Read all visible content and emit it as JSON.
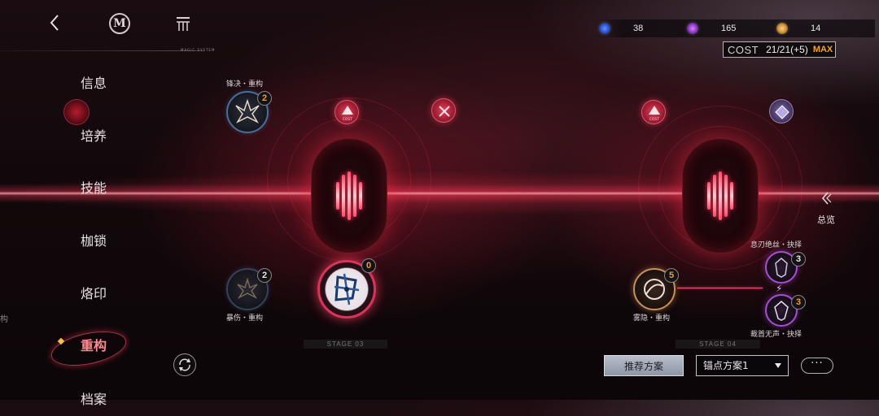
{
  "resources": [
    {
      "icon": "blue-orb-icon",
      "color": "#2f5bd8",
      "value": "38"
    },
    {
      "icon": "purple-orb-icon",
      "color": "#9b3fd0",
      "value": "165"
    },
    {
      "icon": "gold-orb-icon",
      "color": "#d89a3a",
      "value": "14"
    }
  ],
  "cost": {
    "label": "COST",
    "value": "21/21(+5)",
    "max": "MAX"
  },
  "header": {
    "system_tag": "MAGIC SYSTEM"
  },
  "nav": {
    "items": [
      {
        "label": "信息"
      },
      {
        "label": "培养"
      },
      {
        "label": "技能"
      },
      {
        "label": "枷锁"
      },
      {
        "label": "烙印"
      },
      {
        "label": "重构",
        "active": true
      },
      {
        "label": "档案"
      }
    ],
    "left_edge_text": "构"
  },
  "nodes": {
    "fengjue": {
      "label": "锋决・重构",
      "count": "2"
    },
    "baoshang": {
      "label": "暴伤・重构",
      "count": "2"
    },
    "stage3_main": {
      "count": "0"
    },
    "cost_icon_a": {
      "text": "COST"
    },
    "cost_icon_b": {
      "text": "COST"
    },
    "wuyin": {
      "label": "雾隐・重构",
      "count": "5"
    },
    "xirenjuesi": {
      "label": "息刃绝丝・抉择",
      "count": "3"
    },
    "caishouwusheng": {
      "label": "裁首无声・抉择",
      "count": "3"
    }
  },
  "stages": {
    "stage3": "STAGE 03",
    "stage4": "STAGE 04"
  },
  "overview": {
    "label": "总览"
  },
  "bottom": {
    "recommend": "推荐方案",
    "plan": "锚点方案1",
    "more": "···"
  },
  "colors": {
    "accent": "#ff3a5a",
    "badge_orange": "#f29a3a",
    "cost_max": "#f0a030"
  }
}
